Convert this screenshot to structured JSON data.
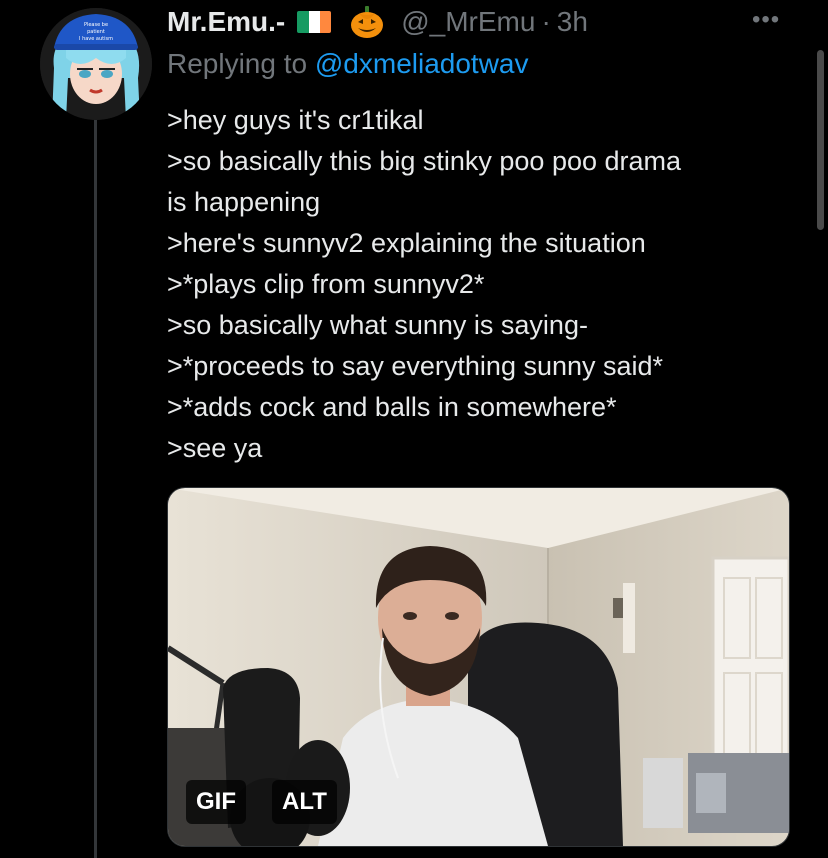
{
  "author": {
    "display_name": "Mr.Emu.-",
    "handle": "@_MrEmu",
    "separator": "·",
    "time": "3h",
    "avatar_cap_text": [
      "Please be",
      "patient",
      "I have autism"
    ]
  },
  "reply": {
    "prefix": "Replying to ",
    "target": "@dxmeliadotwav"
  },
  "more_label": "•••",
  "body_lines": [
    ">hey guys it's cr1tikal",
    ">so basically this big stinky poo poo drama",
    "is happening",
    ">here's sunnyv2 explaining the situation",
    ">*plays clip from sunnyv2*",
    ">so basically what sunny is saying-",
    ">*proceeds to say everything sunny said*",
    ">*adds cock and balls in somewhere*",
    ">see ya"
  ],
  "media": {
    "gif_label": "GIF",
    "alt_label": "ALT"
  },
  "colors": {
    "background": "#000000",
    "primary_text": "#e7e9ea",
    "secondary_text": "#71767b",
    "link": "#1d9bf0",
    "flag": [
      "#169b62",
      "#ffffff",
      "#ff883e"
    ]
  }
}
